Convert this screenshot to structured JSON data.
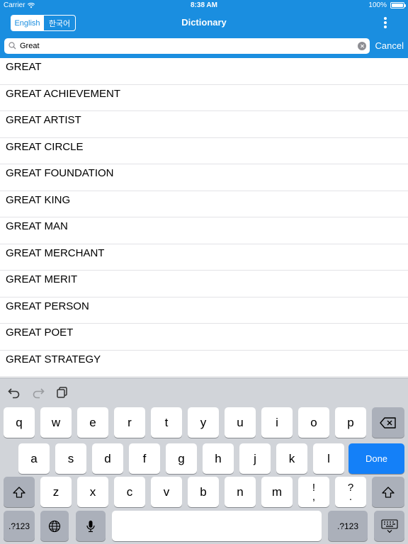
{
  "status_bar": {
    "carrier": "Carrier",
    "time": "8:38 AM",
    "battery": "100%"
  },
  "nav": {
    "title": "Dictionary",
    "segments": [
      {
        "label": "English",
        "selected": true
      },
      {
        "label": "한국어",
        "selected": false
      }
    ]
  },
  "search": {
    "value": "Great",
    "cancel_label": "Cancel"
  },
  "results": [
    "GREAT",
    "GREAT ACHIEVEMENT",
    "GREAT ARTIST",
    "GREAT CIRCLE",
    "GREAT FOUNDATION",
    "GREAT KING",
    "GREAT MAN",
    "GREAT MERCHANT",
    "GREAT MERIT",
    "GREAT PERSON",
    "GREAT POET",
    "GREAT STRATEGY"
  ],
  "keyboard": {
    "row1": [
      "q",
      "w",
      "e",
      "r",
      "t",
      "y",
      "u",
      "i",
      "o",
      "p"
    ],
    "row2": [
      "a",
      "s",
      "d",
      "f",
      "g",
      "h",
      "j",
      "k",
      "l"
    ],
    "row3": [
      "z",
      "x",
      "c",
      "v",
      "b",
      "n",
      "m"
    ],
    "row3_punct": [
      {
        "top": "!",
        "bottom": ","
      },
      {
        "top": "?",
        "bottom": "."
      }
    ],
    "done_label": "Done",
    "numbers_label": ".?123"
  },
  "colors": {
    "accent": "#1a8ee0",
    "done_key": "#1480f8",
    "keyboard_bg": "#d1d4d9"
  }
}
